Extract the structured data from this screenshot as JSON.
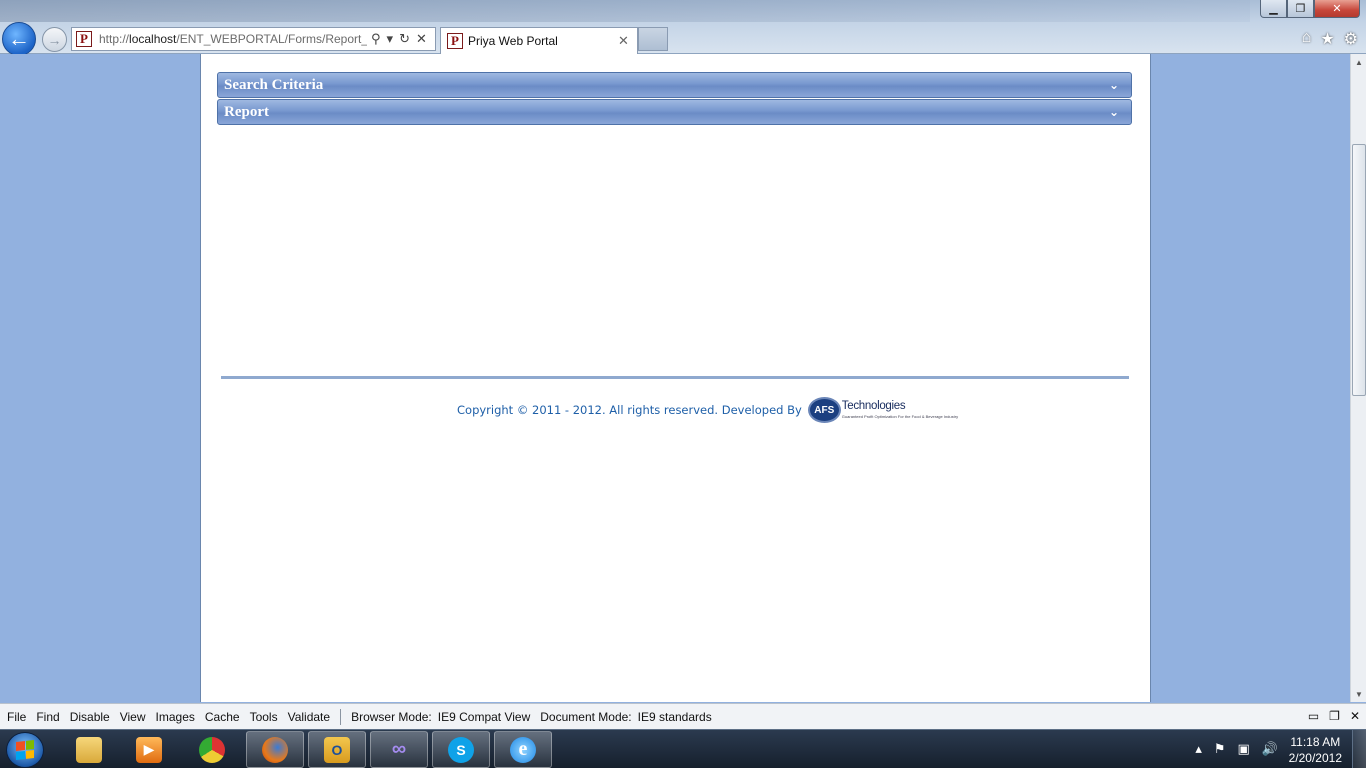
{
  "browser": {
    "url_prefix": "http://",
    "url_host": "localhost",
    "url_path": "/ENT_WEBPORTAL/Forms/Report_I",
    "tab_title": "Priya Web Portal",
    "favicon_letter": "P"
  },
  "page": {
    "panels": [
      {
        "title": "Search Criteria"
      },
      {
        "title": "Report"
      }
    ],
    "footer": {
      "copyright": "Copyright © 2011 - 2012. All rights reserved. Developed By",
      "logo_mark": "AFS",
      "logo_name": "Technologies",
      "logo_tagline": "Guaranteed Profit Optimization For the Food & Beverage Industry"
    }
  },
  "devtools": {
    "menu": [
      "File",
      "Find",
      "Disable",
      "View",
      "Images",
      "Cache",
      "Tools",
      "Validate"
    ],
    "browser_mode_label": "Browser Mode:",
    "browser_mode_value": "IE9 Compat View",
    "document_mode_label": "Document Mode:",
    "document_mode_value": "IE9 standards"
  },
  "taskbar": {
    "time": "11:18 AM",
    "date": "2/20/2012"
  },
  "colors": {
    "page_background": "#92b1df",
    "panel_header": "#6b8cc6",
    "footer_text": "#1e5fa8"
  }
}
